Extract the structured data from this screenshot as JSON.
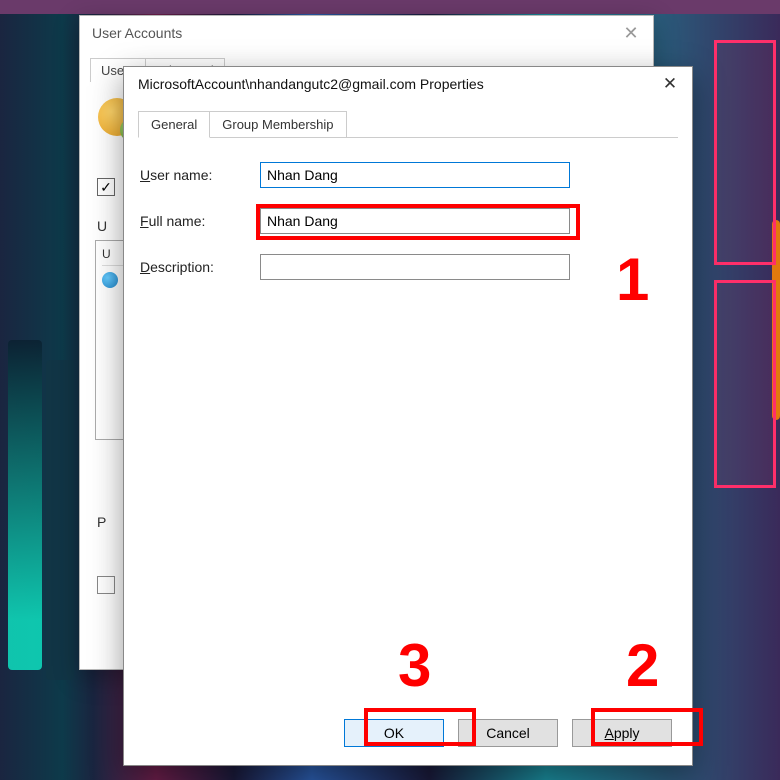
{
  "back_dialog": {
    "title": "User Accounts",
    "tabs": [
      "Users",
      "Advanced"
    ],
    "checkbox_checked": "✓",
    "label_u": "U",
    "list_header": "U",
    "label_p": "P"
  },
  "front_dialog": {
    "title": "MicrosoftAccount\\nhandangutc2@gmail.com Properties",
    "tabs": {
      "general": "General",
      "group": "Group Membership"
    },
    "labels": {
      "username_pre": "",
      "username_u": "U",
      "username_post": "ser name:",
      "fullname_pre": "",
      "fullname_u": "F",
      "fullname_post": "ull name:",
      "description_pre": "",
      "description_u": "D",
      "description_post": "escription:"
    },
    "values": {
      "username": "Nhan Dang",
      "fullname": "Nhan Dang",
      "description": ""
    },
    "buttons": {
      "ok": "OK",
      "cancel": "Cancel",
      "apply_u": "A",
      "apply_post": "pply"
    }
  },
  "annotations": {
    "one": "1",
    "two": "2",
    "three": "3"
  }
}
